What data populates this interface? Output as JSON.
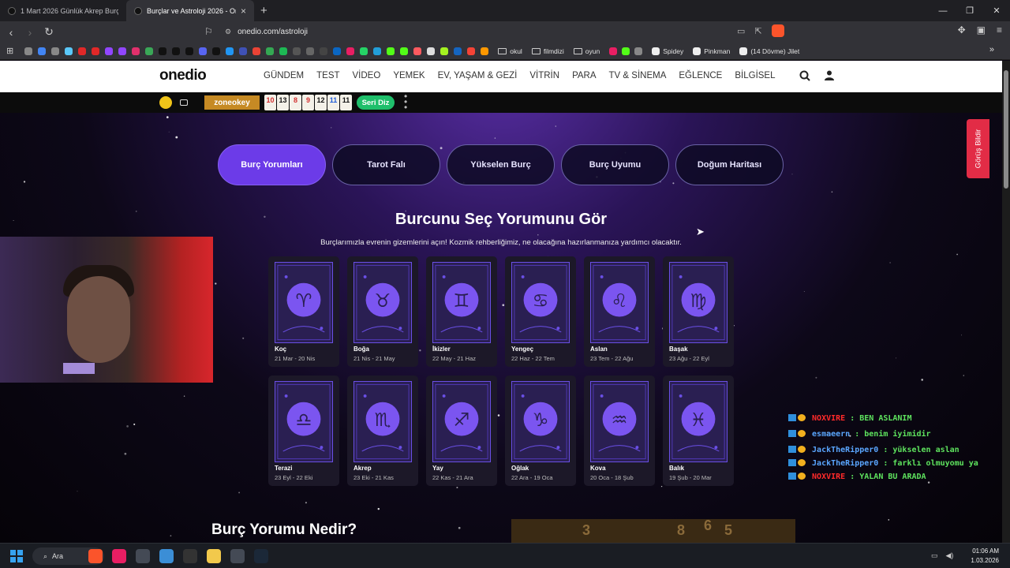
{
  "browser": {
    "tabs": [
      {
        "title": "1 Mart 2026 Günlük Akrep Burç Yorum"
      },
      {
        "title": "Burçlar ve Astroloji 2026 - Onedio",
        "close": "×"
      }
    ],
    "new_tab": "+",
    "window_controls": [
      "—",
      "❐",
      "✕"
    ],
    "url": "onedio.com/astroloji",
    "bookmarks": [
      {
        "label": "okul"
      },
      {
        "label": "filmdizi"
      },
      {
        "label": "oyun"
      },
      {
        "label": "Spidey"
      },
      {
        "label": "Pinkman"
      },
      {
        "label": "(14 Dövme) Jilet"
      }
    ],
    "bookmark_icon_colors": [
      "#888888",
      "#4285f4",
      "#888888",
      "#5ac8fa",
      "#e12828",
      "#e12828",
      "#9146ff",
      "#9146ff",
      "#e1306c",
      "#3aa757",
      "#111111",
      "#111111",
      "#111111",
      "#5865f2",
      "#111111",
      "#2196f3",
      "#3f51b5",
      "#ea4335",
      "#34a853",
      "#1db954",
      "#555555",
      "#666666",
      "#444444",
      "#0a66c2",
      "#e91e63",
      "#25d366",
      "#229ed9",
      "#53fc18",
      "#53fc18",
      "#ff5a5f",
      "#dddddd",
      "#a4f221",
      "#1565c0",
      "#f44336",
      "#ff9800"
    ]
  },
  "site": {
    "logo": "onedio",
    "nav": [
      "GÜNDEM",
      "TEST",
      "VİDEO",
      "YEMEK",
      "EV, YAŞAM & GEZİ",
      "VİTRİN",
      "PARA",
      "TV & SİNEMA",
      "EĞLENCE",
      "BİLGİSEL"
    ],
    "search_icon": "search-icon",
    "user_icon": "user-icon"
  },
  "promo": {
    "zone_label": "zoneokey",
    "tiles": [
      {
        "n": "10",
        "c": "#d32f2f"
      },
      {
        "n": "13",
        "c": "#111111"
      },
      {
        "n": "8",
        "c": "#d32f2f"
      },
      {
        "n": "9",
        "c": "#d32f2f"
      },
      {
        "n": "12",
        "c": "#111111"
      },
      {
        "n": "11",
        "c": "#1e5bd8"
      },
      {
        "n": "11",
        "c": "#111111"
      }
    ],
    "cta": "Seri Diz"
  },
  "tabs": [
    {
      "label": "Burç Yorumları",
      "active": true
    },
    {
      "label": "Tarot Falı",
      "active": false
    },
    {
      "label": "Yükselen Burç",
      "active": false
    },
    {
      "label": "Burç Uyumu",
      "active": false
    },
    {
      "label": "Doğum Haritası",
      "active": false
    }
  ],
  "feedback_label": "Görüş Bildir",
  "heading": "Burcunu Seç Yorumunu Gör",
  "subheading": "Burçlarımızla evrenin gizemlerini açın! Kozmik rehberliğimiz, ne olacağına hazırlanmanıza yardımcı olacaktır.",
  "signs": [
    {
      "name": "Koç",
      "dates": "21 Mar - 20 Nis"
    },
    {
      "name": "Boğa",
      "dates": "21 Nis - 21 May"
    },
    {
      "name": "İkizler",
      "dates": "22 May - 21 Haz"
    },
    {
      "name": "Yengeç",
      "dates": "22 Haz - 22 Tem"
    },
    {
      "name": "Aslan",
      "dates": "23 Tem - 22 Ağu"
    },
    {
      "name": "Başak",
      "dates": "23 Ağu - 22 Eyl"
    },
    {
      "name": "Terazi",
      "dates": "23 Eyl - 22 Eki"
    },
    {
      "name": "Akrep",
      "dates": "23 Eki - 21 Kas"
    },
    {
      "name": "Yay",
      "dates": "22 Kas - 21 Ara"
    },
    {
      "name": "Oğlak",
      "dates": "22 Ara - 19 Oca"
    },
    {
      "name": "Kova",
      "dates": "20 Oca - 18 Şub"
    },
    {
      "name": "Balık",
      "dates": "19 Şub - 20 Mar"
    }
  ],
  "section_title": "Burç Yorumu Nedir?",
  "overlay_digits": [
    "3",
    "8",
    "6",
    "5"
  ],
  "chat": [
    {
      "user": "NOXVIRE",
      "color": "red",
      "msg": "BEN ASLANIM"
    },
    {
      "user": "esmaeern",
      "color": "blue",
      "msg": "benim iyimidir"
    },
    {
      "user": "JackTheRipper0",
      "color": "blue",
      "msg": "yükselen aslan"
    },
    {
      "user": "JackTheRipper0",
      "color": "blue",
      "msg": "farklı olmuyomu ya"
    },
    {
      "user": "NOXVIRE",
      "color": "red",
      "msg": "YALAN BU ARADA"
    }
  ],
  "taskbar": {
    "search": "Ara",
    "app_colors": [
      "#fb542b",
      "#e91e63",
      "#444a55",
      "#3b8ed6",
      "#333333",
      "#f2c94c",
      "#444a55",
      "#1b2838"
    ],
    "time": "01:06 AM",
    "date": "1.03.2026"
  }
}
